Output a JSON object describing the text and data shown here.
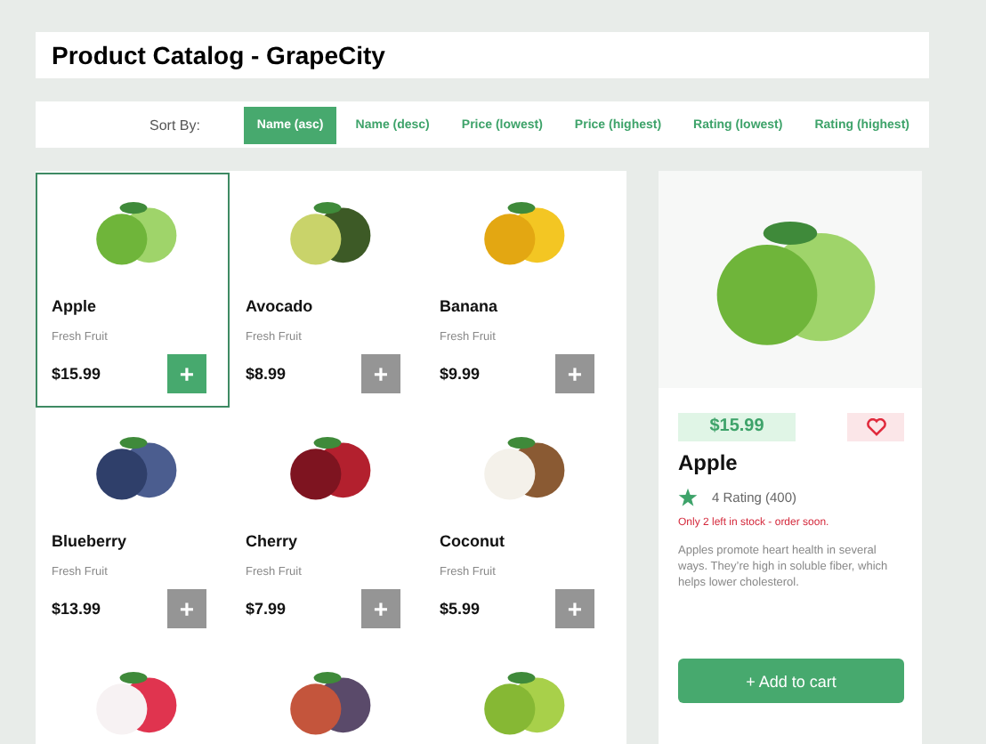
{
  "header": {
    "title": "Product Catalog - GrapeCity"
  },
  "sort_bar": {
    "label": "Sort By:",
    "options": [
      {
        "label": "Name (asc)",
        "selected": true
      },
      {
        "label": "Name (desc)",
        "selected": false
      },
      {
        "label": "Price (lowest)",
        "selected": false
      },
      {
        "label": "Price (highest)",
        "selected": false
      },
      {
        "label": "Rating (lowest)",
        "selected": false
      },
      {
        "label": "Rating (highest)",
        "selected": false
      }
    ]
  },
  "products": [
    {
      "name": "Apple",
      "category": "Fresh Fruit",
      "price": "$15.99",
      "selected": true,
      "add_button": "+"
    },
    {
      "name": "Avocado",
      "category": "Fresh Fruit",
      "price": "$8.99",
      "selected": false,
      "add_button": "+"
    },
    {
      "name": "Banana",
      "category": "Fresh Fruit",
      "price": "$9.99",
      "selected": false,
      "add_button": "+"
    },
    {
      "name": "Blueberry",
      "category": "Fresh Fruit",
      "price": "$13.99",
      "selected": false,
      "add_button": "+"
    },
    {
      "name": "Cherry",
      "category": "Fresh Fruit",
      "price": "$7.99",
      "selected": false,
      "add_button": "+"
    },
    {
      "name": "Coconut",
      "category": "Fresh Fruit",
      "price": "$5.99",
      "selected": false,
      "add_button": "+"
    },
    {
      "selected": false
    },
    {
      "selected": false
    },
    {
      "selected": false
    }
  ],
  "detail": {
    "price": "$15.99",
    "favorite": false,
    "name": "Apple",
    "rating": "4 Rating (400)",
    "stock_note": "Only 2 left in stock - order soon.",
    "description": "Apples promote heart health in several ways. They’re high in soluble fiber, which helps lower cholesterol.",
    "add_to_cart": "+ Add to cart"
  }
}
